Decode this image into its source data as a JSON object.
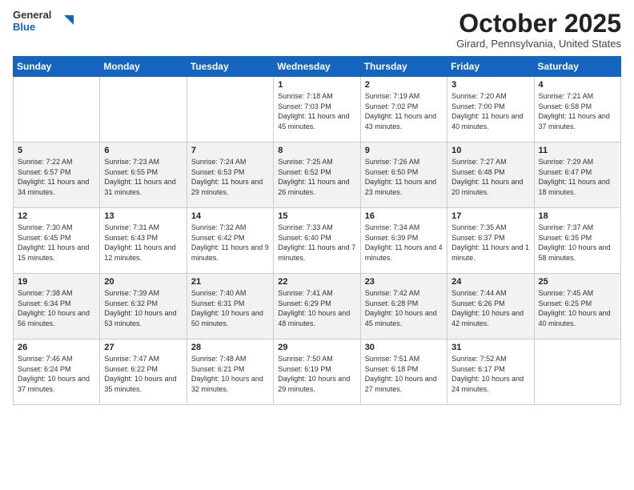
{
  "header": {
    "logo_general": "General",
    "logo_blue": "Blue",
    "month_title": "October 2025",
    "subtitle": "Girard, Pennsylvania, United States"
  },
  "calendar": {
    "days_of_week": [
      "Sunday",
      "Monday",
      "Tuesday",
      "Wednesday",
      "Thursday",
      "Friday",
      "Saturday"
    ],
    "weeks": [
      [
        {
          "day": "",
          "info": ""
        },
        {
          "day": "",
          "info": ""
        },
        {
          "day": "",
          "info": ""
        },
        {
          "day": "1",
          "info": "Sunrise: 7:18 AM\nSunset: 7:03 PM\nDaylight: 11 hours and 45 minutes."
        },
        {
          "day": "2",
          "info": "Sunrise: 7:19 AM\nSunset: 7:02 PM\nDaylight: 11 hours and 43 minutes."
        },
        {
          "day": "3",
          "info": "Sunrise: 7:20 AM\nSunset: 7:00 PM\nDaylight: 11 hours and 40 minutes."
        },
        {
          "day": "4",
          "info": "Sunrise: 7:21 AM\nSunset: 6:58 PM\nDaylight: 11 hours and 37 minutes."
        }
      ],
      [
        {
          "day": "5",
          "info": "Sunrise: 7:22 AM\nSunset: 6:57 PM\nDaylight: 11 hours and 34 minutes."
        },
        {
          "day": "6",
          "info": "Sunrise: 7:23 AM\nSunset: 6:55 PM\nDaylight: 11 hours and 31 minutes."
        },
        {
          "day": "7",
          "info": "Sunrise: 7:24 AM\nSunset: 6:53 PM\nDaylight: 11 hours and 29 minutes."
        },
        {
          "day": "8",
          "info": "Sunrise: 7:25 AM\nSunset: 6:52 PM\nDaylight: 11 hours and 26 minutes."
        },
        {
          "day": "9",
          "info": "Sunrise: 7:26 AM\nSunset: 6:50 PM\nDaylight: 11 hours and 23 minutes."
        },
        {
          "day": "10",
          "info": "Sunrise: 7:27 AM\nSunset: 6:48 PM\nDaylight: 11 hours and 20 minutes."
        },
        {
          "day": "11",
          "info": "Sunrise: 7:29 AM\nSunset: 6:47 PM\nDaylight: 11 hours and 18 minutes."
        }
      ],
      [
        {
          "day": "12",
          "info": "Sunrise: 7:30 AM\nSunset: 6:45 PM\nDaylight: 11 hours and 15 minutes."
        },
        {
          "day": "13",
          "info": "Sunrise: 7:31 AM\nSunset: 6:43 PM\nDaylight: 11 hours and 12 minutes."
        },
        {
          "day": "14",
          "info": "Sunrise: 7:32 AM\nSunset: 6:42 PM\nDaylight: 11 hours and 9 minutes."
        },
        {
          "day": "15",
          "info": "Sunrise: 7:33 AM\nSunset: 6:40 PM\nDaylight: 11 hours and 7 minutes."
        },
        {
          "day": "16",
          "info": "Sunrise: 7:34 AM\nSunset: 6:39 PM\nDaylight: 11 hours and 4 minutes."
        },
        {
          "day": "17",
          "info": "Sunrise: 7:35 AM\nSunset: 6:37 PM\nDaylight: 11 hours and 1 minute."
        },
        {
          "day": "18",
          "info": "Sunrise: 7:37 AM\nSunset: 6:35 PM\nDaylight: 10 hours and 58 minutes."
        }
      ],
      [
        {
          "day": "19",
          "info": "Sunrise: 7:38 AM\nSunset: 6:34 PM\nDaylight: 10 hours and 56 minutes."
        },
        {
          "day": "20",
          "info": "Sunrise: 7:39 AM\nSunset: 6:32 PM\nDaylight: 10 hours and 53 minutes."
        },
        {
          "day": "21",
          "info": "Sunrise: 7:40 AM\nSunset: 6:31 PM\nDaylight: 10 hours and 50 minutes."
        },
        {
          "day": "22",
          "info": "Sunrise: 7:41 AM\nSunset: 6:29 PM\nDaylight: 10 hours and 48 minutes."
        },
        {
          "day": "23",
          "info": "Sunrise: 7:42 AM\nSunset: 6:28 PM\nDaylight: 10 hours and 45 minutes."
        },
        {
          "day": "24",
          "info": "Sunrise: 7:44 AM\nSunset: 6:26 PM\nDaylight: 10 hours and 42 minutes."
        },
        {
          "day": "25",
          "info": "Sunrise: 7:45 AM\nSunset: 6:25 PM\nDaylight: 10 hours and 40 minutes."
        }
      ],
      [
        {
          "day": "26",
          "info": "Sunrise: 7:46 AM\nSunset: 6:24 PM\nDaylight: 10 hours and 37 minutes."
        },
        {
          "day": "27",
          "info": "Sunrise: 7:47 AM\nSunset: 6:22 PM\nDaylight: 10 hours and 35 minutes."
        },
        {
          "day": "28",
          "info": "Sunrise: 7:48 AM\nSunset: 6:21 PM\nDaylight: 10 hours and 32 minutes."
        },
        {
          "day": "29",
          "info": "Sunrise: 7:50 AM\nSunset: 6:19 PM\nDaylight: 10 hours and 29 minutes."
        },
        {
          "day": "30",
          "info": "Sunrise: 7:51 AM\nSunset: 6:18 PM\nDaylight: 10 hours and 27 minutes."
        },
        {
          "day": "31",
          "info": "Sunrise: 7:52 AM\nSunset: 6:17 PM\nDaylight: 10 hours and 24 minutes."
        },
        {
          "day": "",
          "info": ""
        }
      ]
    ]
  }
}
